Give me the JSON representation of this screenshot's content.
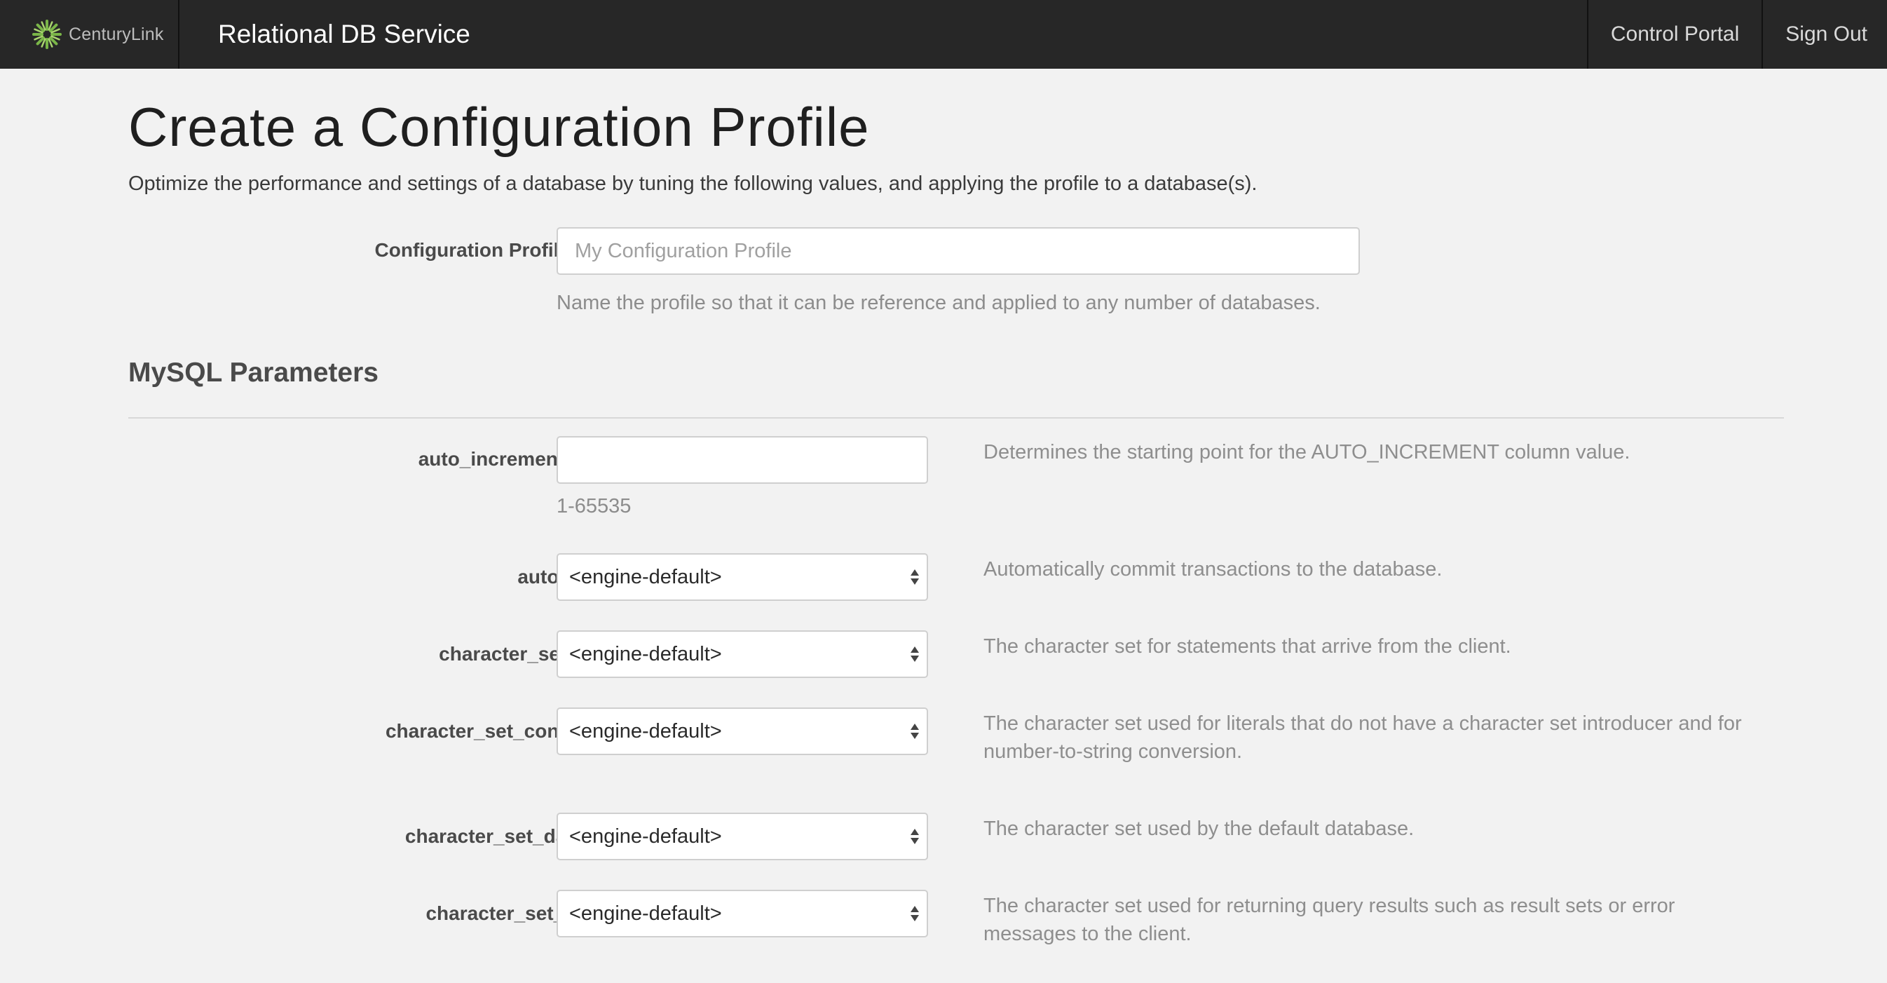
{
  "header": {
    "brand_name": "CenturyLink",
    "app_title": "Relational DB Service",
    "nav": [
      {
        "label": "Control Portal"
      },
      {
        "label": "Sign Out"
      }
    ]
  },
  "page": {
    "title": "Create a Configuration Profile",
    "description": "Optimize the performance and settings of a database by tuning the following values, and applying the profile to a database(s)."
  },
  "profile_name": {
    "label": "Configuration Profile Name",
    "value": "",
    "placeholder": "My Configuration Profile",
    "help": "Name the profile so that it can be reference and applied to any number of databases."
  },
  "mysql": {
    "section_title": "MySQL Parameters",
    "params": [
      {
        "name": "auto_increment_offset",
        "type": "text",
        "value": "",
        "help": "1-65535",
        "description": "Determines the starting point for the AUTO_INCREMENT column value."
      },
      {
        "name": "autocommit",
        "type": "select",
        "value": "<engine-default>",
        "description": "Automatically commit transactions to the database."
      },
      {
        "name": "character_set_client",
        "type": "select",
        "value": "<engine-default>",
        "description": "The character set for statements that arrive from the client."
      },
      {
        "name": "character_set_connection",
        "type": "select",
        "value": "<engine-default>",
        "description": "The character set used for literals that do not have a character set introducer and for number-to-string conversion."
      },
      {
        "name": "character_set_database",
        "type": "select",
        "value": "<engine-default>",
        "description": "The character set used by the default database."
      },
      {
        "name": "character_set_results",
        "type": "select",
        "value": "<engine-default>",
        "description": "The character set used for returning query results such as result sets or error messages to the client."
      }
    ]
  },
  "colors": {
    "navbar_bg": "#272727",
    "page_bg": "#f2f2f2",
    "brand_accent": "#7ab648"
  },
  "icons": {
    "brand_logo": "centurylink-burst-icon",
    "select_arrows": "up-down-caret-icon"
  }
}
